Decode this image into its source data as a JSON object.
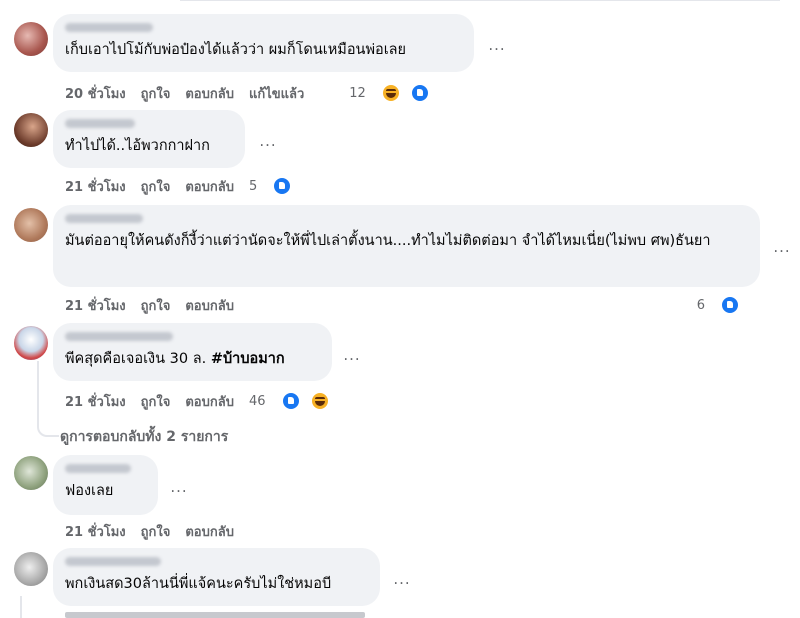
{
  "comments": [
    {
      "text": "เก็บเอาไปโม้กับพ่อป๋องได้แล้วว่า ผมก็โดนเหมือนพ่อเลย",
      "time": "20 ชั่วโมง",
      "like_label": "ถูกใจ",
      "reply_label": "ตอบกลับ",
      "edited_label": "แก้ไขแล้ว",
      "reaction_count": "12",
      "reactions": [
        "haha-icon",
        "like-icon"
      ],
      "more_label": "..."
    },
    {
      "text": "ทำไปได้..ไอ้พวกกาฝาก",
      "time": "21 ชั่วโมง",
      "like_label": "ถูกใจ",
      "reply_label": "ตอบกลับ",
      "reaction_count": "5",
      "reactions": [
        "like-icon"
      ],
      "more_label": "..."
    },
    {
      "text": "มันต่ออายุให้คนดังก็งี้ว่าแต่ว่านัดจะให้พี่ไปเล่าตั้งนาน....ทำไมไม่ติดต่อมา จำได้ไหมเนี่ย(ไม่พบ ศพ)ธันยา",
      "time": "21 ชั่วโมง",
      "like_label": "ถูกใจ",
      "reply_label": "ตอบกลับ",
      "reaction_count": "6",
      "reactions": [
        "like-icon"
      ],
      "more_label": "..."
    },
    {
      "text_plain": "พีคสุดคือเจอเงิน 30 ล. ",
      "hashtag": "#บ้าบอมาก",
      "time": "21 ชั่วโมง",
      "like_label": "ถูกใจ",
      "reply_label": "ตอบกลับ",
      "reaction_count": "46",
      "reactions": [
        "like-icon",
        "haha-icon"
      ],
      "more_label": "..."
    },
    {
      "text": "ฟองเลย",
      "time": "21 ชั่วโมง",
      "like_label": "ถูกใจ",
      "reply_label": "ตอบกลับ",
      "more_label": "..."
    },
    {
      "text": "พกเงินสด30ล้านนี่พี่แจ้คนะครับไม่ใช่หมอบี",
      "more_label": "..."
    }
  ],
  "view_replies_label": "ดูการตอบกลับทั้ง 2 รายการ",
  "colors": {
    "bubble": "#f0f2f5",
    "meta": "#65676b",
    "like": "#1877f2",
    "haha": "#f7b125"
  }
}
